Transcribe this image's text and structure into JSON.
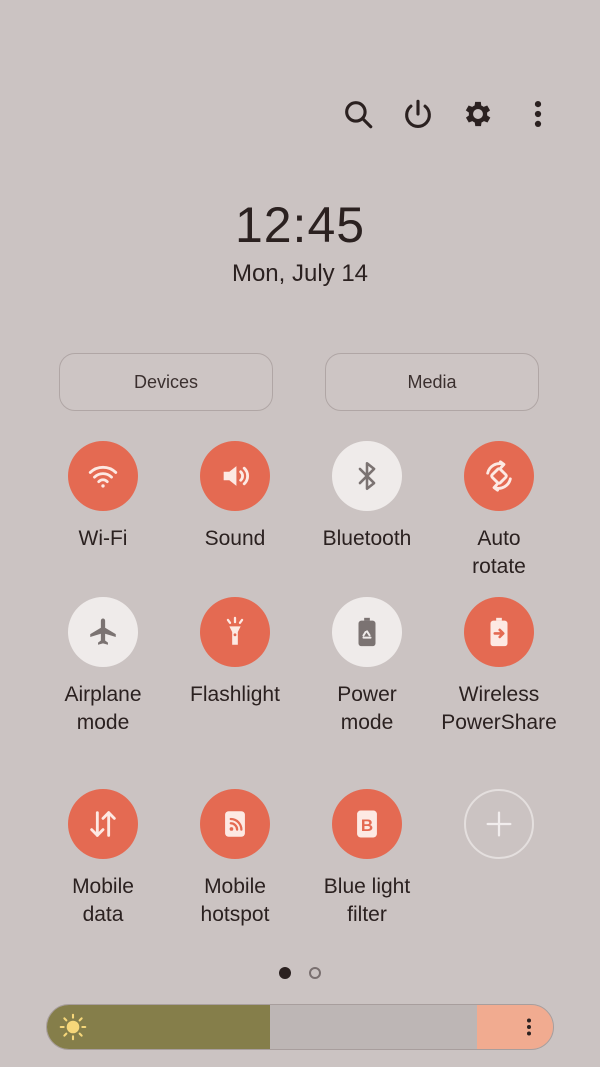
{
  "header": {
    "actions": [
      {
        "name": "search-icon"
      },
      {
        "name": "power-icon"
      },
      {
        "name": "gear-icon"
      },
      {
        "name": "more-vertical-icon"
      }
    ]
  },
  "clock": {
    "time": "12:45",
    "date": "Mon, July 14"
  },
  "pills": {
    "devices": "Devices",
    "media": "Media"
  },
  "tiles": [
    {
      "label": "Wi-Fi",
      "state": "on",
      "icon": "wifi-icon"
    },
    {
      "label": "Sound",
      "state": "on",
      "icon": "speaker-icon"
    },
    {
      "label": "Bluetooth",
      "state": "off",
      "icon": "bluetooth-icon"
    },
    {
      "label": "Auto\nrotate",
      "state": "on",
      "icon": "rotate-icon"
    },
    {
      "label": "Airplane\nmode",
      "state": "off",
      "icon": "airplane-icon"
    },
    {
      "label": "Flashlight",
      "state": "on",
      "icon": "flashlight-icon"
    },
    {
      "label": "Power\nmode",
      "state": "off",
      "icon": "battery-recycle-icon"
    },
    {
      "label": "Wireless\nPowerShare",
      "state": "on",
      "icon": "powershare-icon"
    },
    {
      "label": "Mobile\ndata",
      "state": "on",
      "icon": "data-arrows-icon"
    },
    {
      "label": "Mobile\nhotspot",
      "state": "on",
      "icon": "hotspot-icon"
    },
    {
      "label": "Blue light\nfilter",
      "state": "on",
      "icon": "blue-light-filter-icon"
    },
    {
      "label": "",
      "state": "add",
      "icon": "plus-icon"
    }
  ],
  "pager": {
    "pages": 2,
    "current": 1
  },
  "brightness": {
    "level": 0.44,
    "colors": {
      "fill": "#857e4a",
      "track": "#bdb6b5",
      "end": "#f1ab90"
    }
  },
  "colors": {
    "accent": "#e46a52",
    "background": "#cbc3c2",
    "tile_off": "#efebea"
  }
}
